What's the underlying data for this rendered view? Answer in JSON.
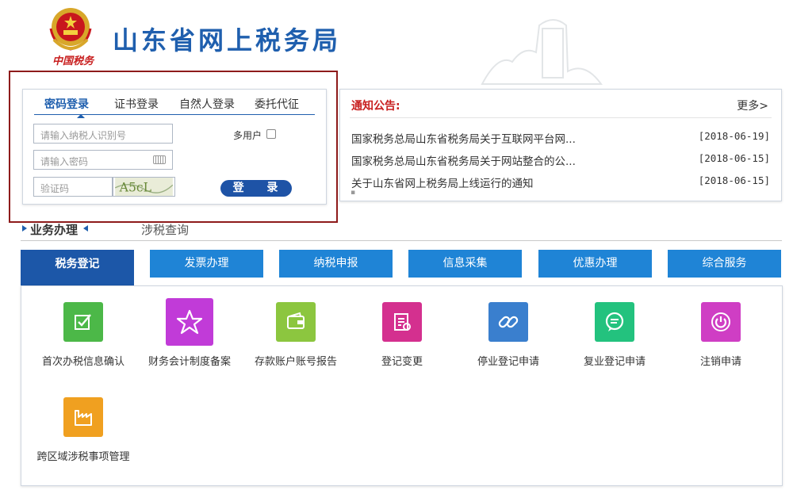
{
  "header": {
    "site_title": "山东省网上税务局",
    "slogan": "中国税务"
  },
  "login": {
    "tabs": [
      "密码登录",
      "证书登录",
      "自然人登录",
      "委托代征"
    ],
    "active_tab": "密码登录",
    "taxpayer_id_placeholder": "请输入纳税人识别号",
    "password_placeholder": "请输入密码",
    "captcha_placeholder": "验证码",
    "captcha_text": "A5cL",
    "multi_user_label": "多用户",
    "login_button": "登 录"
  },
  "notice": {
    "title": "通知公告:",
    "more": "更多>",
    "items": [
      {
        "title": "国家税务总局山东省税务局关于互联网平台网...",
        "date": "[2018-06-19]"
      },
      {
        "title": "国家税务总局山东省税务局关于网站整合的公...",
        "date": "[2018-06-15]"
      },
      {
        "title": "关于山东省网上税务局上线运行的通知",
        "date": "[2018-06-15]"
      }
    ]
  },
  "section": {
    "tabs": [
      "业务办理",
      "涉税查询"
    ],
    "categories": [
      "税务登记",
      "发票办理",
      "纳税申报",
      "信息采集",
      "优惠办理",
      "综合服务"
    ]
  },
  "services": [
    {
      "label": "首次办税信息确认",
      "icon": "checkbox-edit-icon",
      "color": "#4cb848"
    },
    {
      "label": "财务会计制度备案",
      "icon": "star-icon",
      "color": "#c13bd8"
    },
    {
      "label": "存款账户账号报告",
      "icon": "wallet-icon",
      "color": "#8cc63f"
    },
    {
      "label": "登记变更",
      "icon": "document-change-icon",
      "color": "#d4308f"
    },
    {
      "label": "停业登记申请",
      "icon": "link-icon",
      "color": "#3a7fce"
    },
    {
      "label": "复业登记申请",
      "icon": "chat-icon",
      "color": "#23c27e"
    },
    {
      "label": "注销申请",
      "icon": "power-icon",
      "color": "#cf3ec4"
    },
    {
      "label": "跨区域涉税事项管理",
      "icon": "factory-icon",
      "color": "#f0a020"
    }
  ]
}
